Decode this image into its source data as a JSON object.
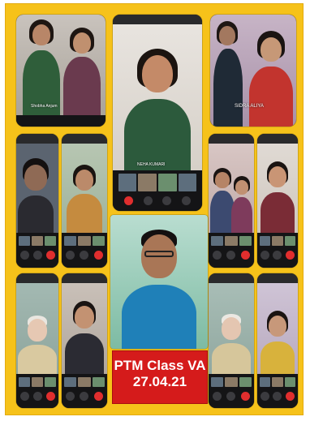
{
  "collage": {
    "caption_line1": "PTM Class VA",
    "caption_line2": "27.04.21"
  },
  "labels": {
    "tile_top_middle": "NEHA KUMARI",
    "tile_top_right": "SIDRA ALIYA",
    "tile_top_left": "Shobha Anjum"
  },
  "colors": {
    "frame": "#f6c21a",
    "caption_bg": "#d51b1b",
    "phone_body": "#1c1c1e",
    "end_call": "#e02e2e"
  }
}
